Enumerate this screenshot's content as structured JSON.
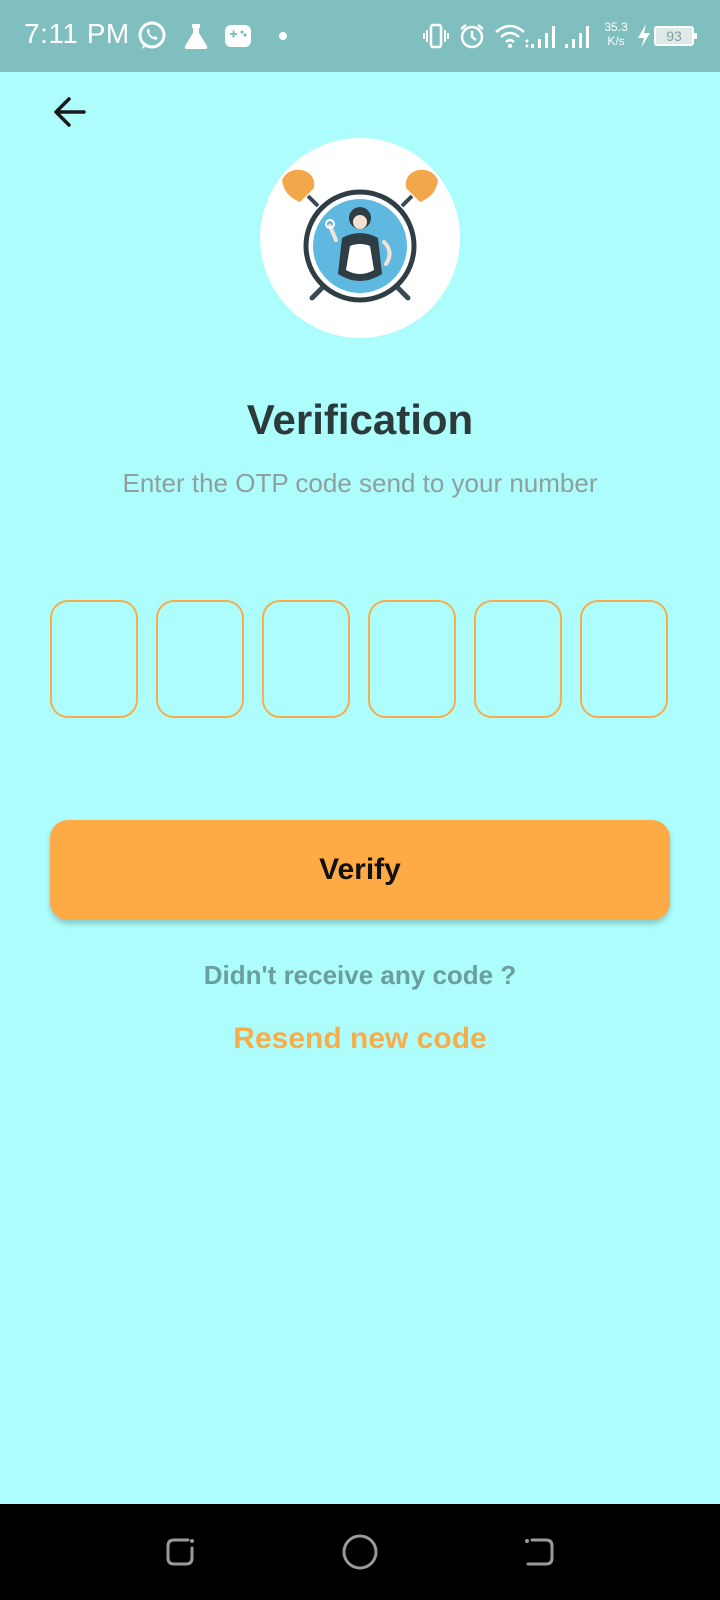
{
  "status_bar": {
    "time": "7:11 PM",
    "net_speed_value": "35.3",
    "net_speed_unit": "K/s",
    "battery": "93",
    "icons": [
      "whatsapp-icon",
      "flask-icon",
      "gamepad-icon",
      "dot-icon",
      "vibrate-icon",
      "alarm-icon",
      "wifi-icon",
      "signal-icon",
      "signal-icon",
      "charging-icon",
      "battery-icon"
    ]
  },
  "header": {
    "back_icon": "arrow-left-icon"
  },
  "logo": {
    "icon": "maid-logo"
  },
  "main": {
    "title": "Verification",
    "subtitle": "Enter the OTP code send to your number",
    "otp_fields": [
      "",
      "",
      "",
      "",
      "",
      ""
    ],
    "verify_label": "Verify",
    "no_code_text": "Didn't receive any code ?",
    "resend_label": "Resend new code"
  },
  "nav_bar": {
    "icons": [
      "recents-icon",
      "home-icon",
      "back-nav-icon"
    ]
  },
  "colors": {
    "background": "#aefdfd",
    "status_bar": "#7fbfbf",
    "accent": "#ffab45",
    "title": "#2b3a3a",
    "subtitle": "#8e9f9f",
    "secondary_text": "#6b9e9e"
  }
}
